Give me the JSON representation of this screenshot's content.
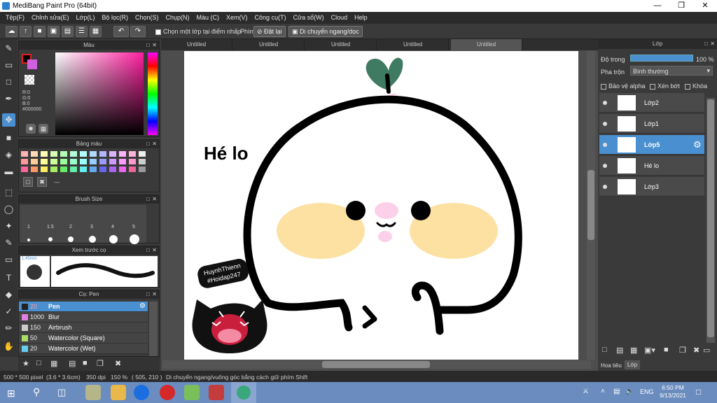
{
  "app": {
    "title": "MediBang Paint Pro (64bit)"
  },
  "menu": [
    "Tệp(F)",
    "Chỉnh sửa(E)",
    "Lớp(L)",
    "Bộ lọc(R)",
    "Chọn(S)",
    "Chụp(N)",
    "Màu (C)",
    "Xem(V)",
    "Công cụ(T)",
    "Cửa sổ(W)",
    "Cloud",
    "Help"
  ],
  "toolbar": {
    "checkbox_label": "Chọn một lớp tại điểm nhấp",
    "phim_label": "Phím",
    "reset_label": "Đặt lại",
    "move_label": "Di chuyển ngang/dọc"
  },
  "tabs": [
    "Untitled",
    "Untitled",
    "Untitled",
    "Untitled",
    "Untitled"
  ],
  "color_panel": {
    "title": "Màu",
    "r": "R:0",
    "g": "G:0",
    "b": "B:0",
    "hex": "#000000"
  },
  "palette_panel": {
    "title": "Bảng màu",
    "dash": "---"
  },
  "brush_size_panel": {
    "title": "Brush Size",
    "sizes": [
      "1",
      "1.5",
      "2",
      "3",
      "4",
      "5"
    ]
  },
  "preview_panel": {
    "title": "Xem trước cọ",
    "size": "1.45mm"
  },
  "brush_panel": {
    "title": "Cọ: Pen",
    "items": [
      {
        "size": "20",
        "name": "Pen",
        "color": "#222222",
        "selected": true
      },
      {
        "size": "1000",
        "name": "Blur",
        "color": "#e080e0",
        "selected": false
      },
      {
        "size": "150",
        "name": "Airbrush",
        "color": "#cccccc",
        "selected": false
      },
      {
        "size": "50",
        "name": "Watercolor (Square)",
        "color": "#aadd66",
        "selected": false
      },
      {
        "size": "20",
        "name": "Watercolor (Wet)",
        "color": "#66ccee",
        "selected": false
      }
    ]
  },
  "canvas": {
    "text": "Hé lo",
    "watermark_line1": "HuynhThienn",
    "watermark_line2": "#Hoidap247"
  },
  "layer_panel": {
    "title": "Lớp",
    "opacity_label": "Độ trong",
    "opacity_value": "100 %",
    "blend_label": "Pha trộn",
    "blend_value": "Bình thường",
    "alpha_label": "Bảo vệ alpha",
    "clip_label": "Xén bớt",
    "lock_label": "Khóa",
    "layers": [
      {
        "name": "Lớp2",
        "selected": false
      },
      {
        "name": "Lớp1",
        "selected": false
      },
      {
        "name": "Lớp5",
        "selected": true
      },
      {
        "name": "Hé lo",
        "selected": false
      },
      {
        "name": "Lớp3",
        "selected": false
      }
    ],
    "bottom_tabs": [
      "Hoa tiêu",
      "Lớp"
    ]
  },
  "statusbar": {
    "size": "500 * 500 pixel",
    "cm": "(3.6 * 3.6cm)",
    "dpi": "350 dpi",
    "zoom": "150 %",
    "coords": "( 505, 210 )",
    "hint": "Di chuyển ngang/vuông góc bằng cách giữ phím Shift"
  },
  "taskbar": {
    "lang": "ENG",
    "time": "6:50 PM",
    "date": "9/13/2021"
  }
}
